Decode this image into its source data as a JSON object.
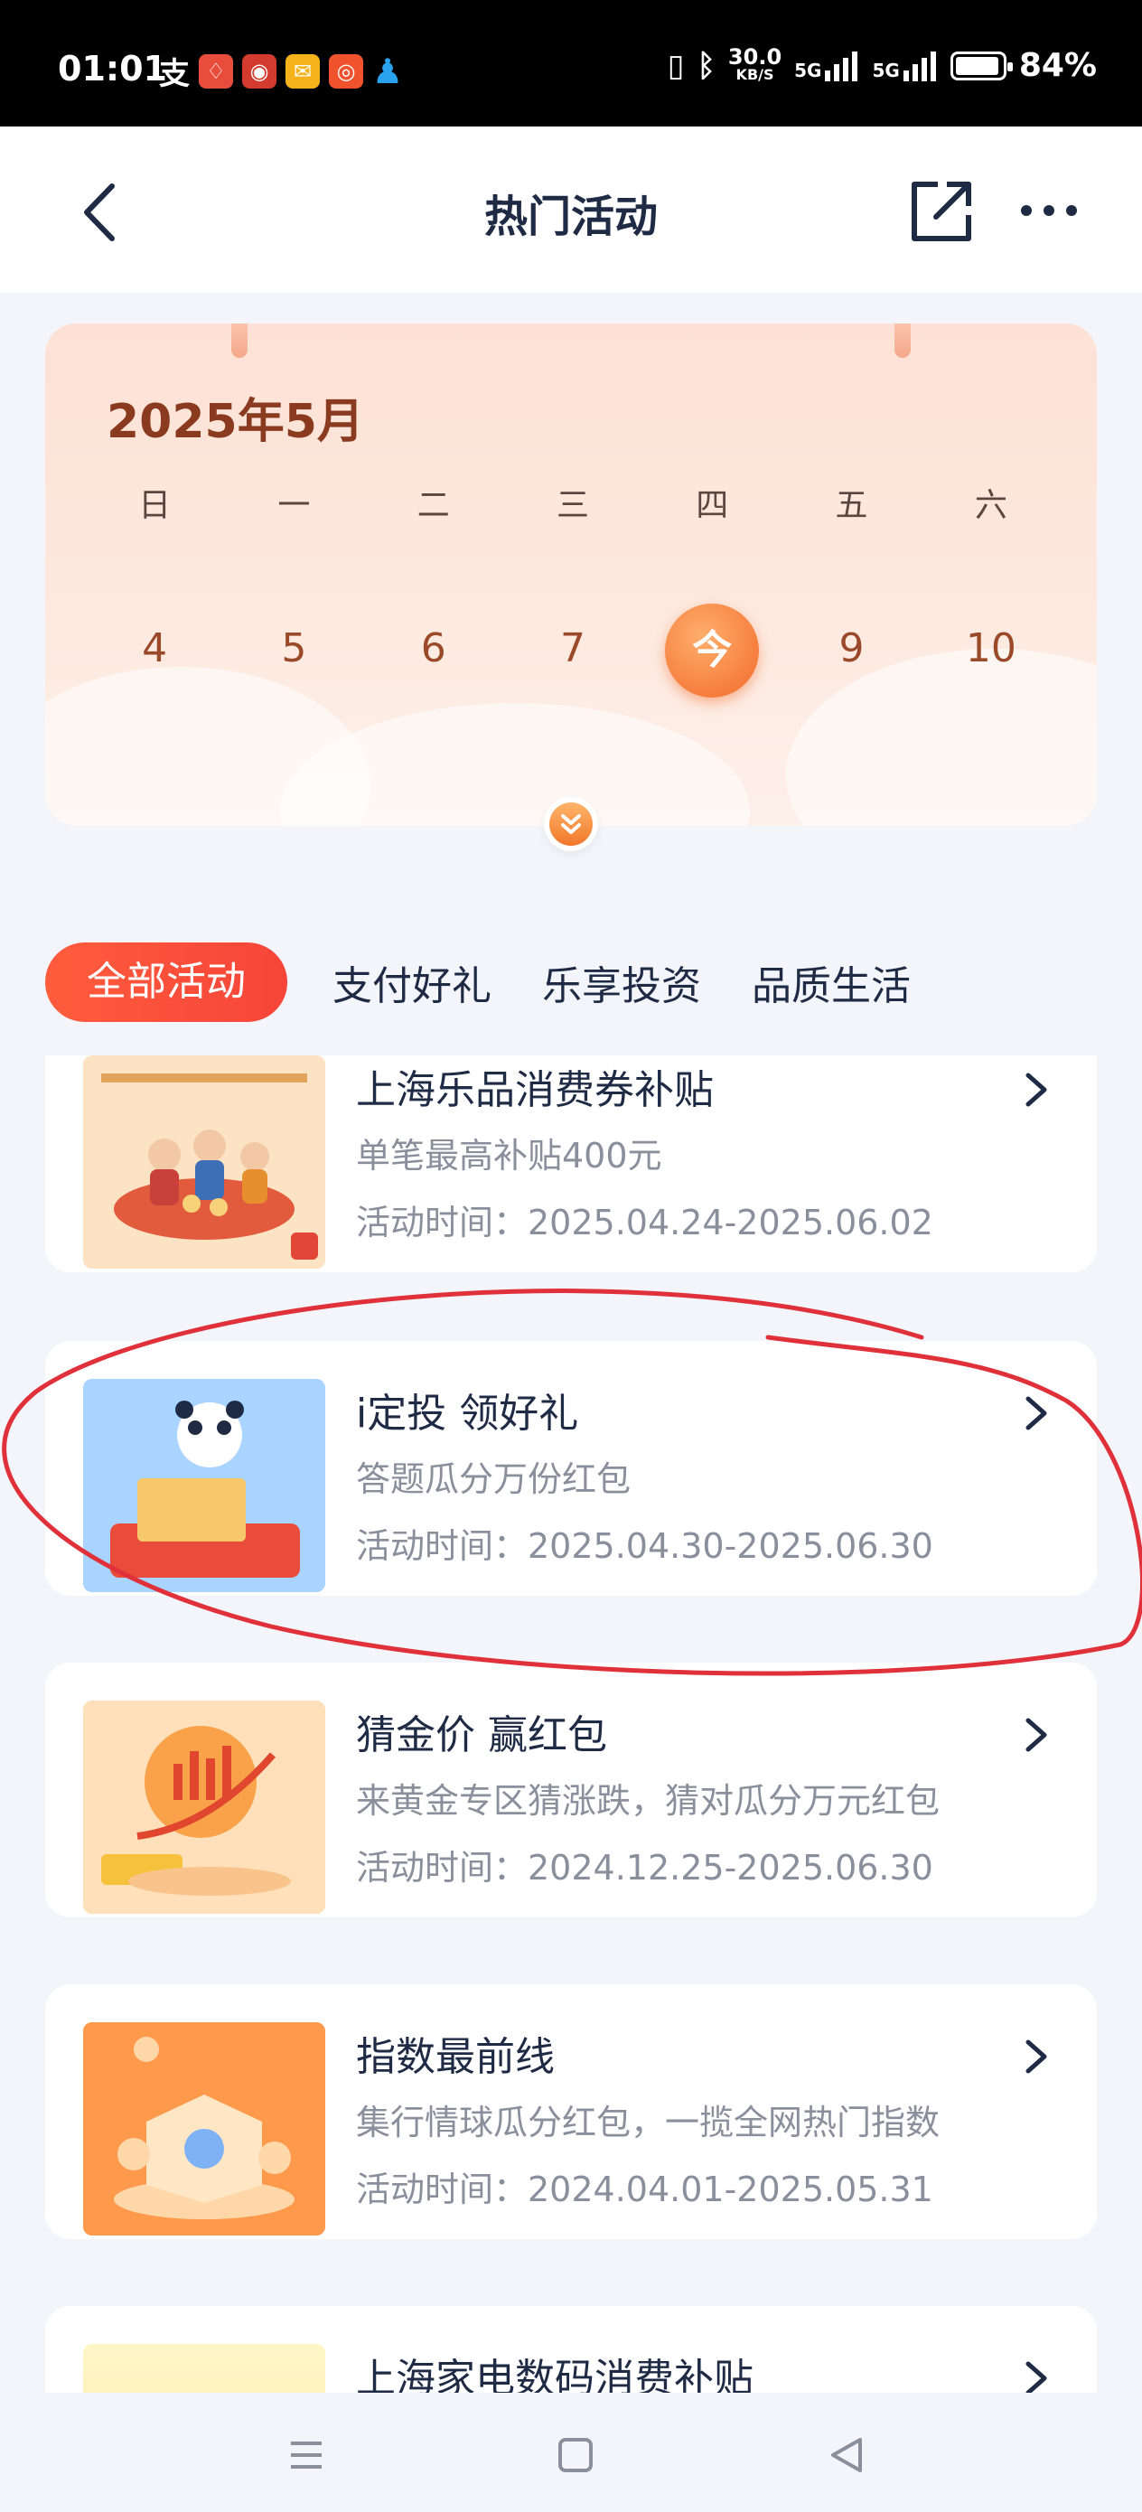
{
  "status_bar": {
    "time": "01:01",
    "speed_value": "30.0",
    "speed_unit": "KB/S",
    "network_1": "5G",
    "network_2": "5G",
    "battery": "84%"
  },
  "header": {
    "title": "热门活动"
  },
  "calendar": {
    "month_label": "2025年5月",
    "weekdays": [
      "日",
      "一",
      "二",
      "三",
      "四",
      "五",
      "六"
    ],
    "days": [
      "4",
      "5",
      "6",
      "7",
      "今",
      "9",
      "10"
    ],
    "today_index": 4,
    "accent_color": "#f26a2a"
  },
  "tabs": [
    {
      "label": "全部活动",
      "active": true
    },
    {
      "label": "支付好礼",
      "active": false
    },
    {
      "label": "乐享投资",
      "active": false
    },
    {
      "label": "品质生活",
      "active": false
    }
  ],
  "activities": [
    {
      "title": "上海乐品消费券补贴",
      "subtitle": "单笔最高补贴400元",
      "period": "活动时间：2025.04.24-2025.06.02"
    },
    {
      "title": "i定投 领好礼",
      "subtitle": "答题瓜分万份红包",
      "period": "活动时间：2025.04.30-2025.06.30"
    },
    {
      "title": "猜金价 赢红包",
      "subtitle": "来黄金专区猜涨跌，猜对瓜分万元红包",
      "period": "活动时间：2024.12.25-2025.06.30"
    },
    {
      "title": "指数最前线",
      "subtitle": "集行情球瓜分红包，一揽全网热门指数",
      "period": "活动时间：2024.04.01-2025.05.31"
    },
    {
      "title": "上海家电数码消费补贴",
      "subtitle": "",
      "period": ""
    }
  ],
  "colors": {
    "tab_active": "#f6453a",
    "annotation": "#e0303a"
  }
}
